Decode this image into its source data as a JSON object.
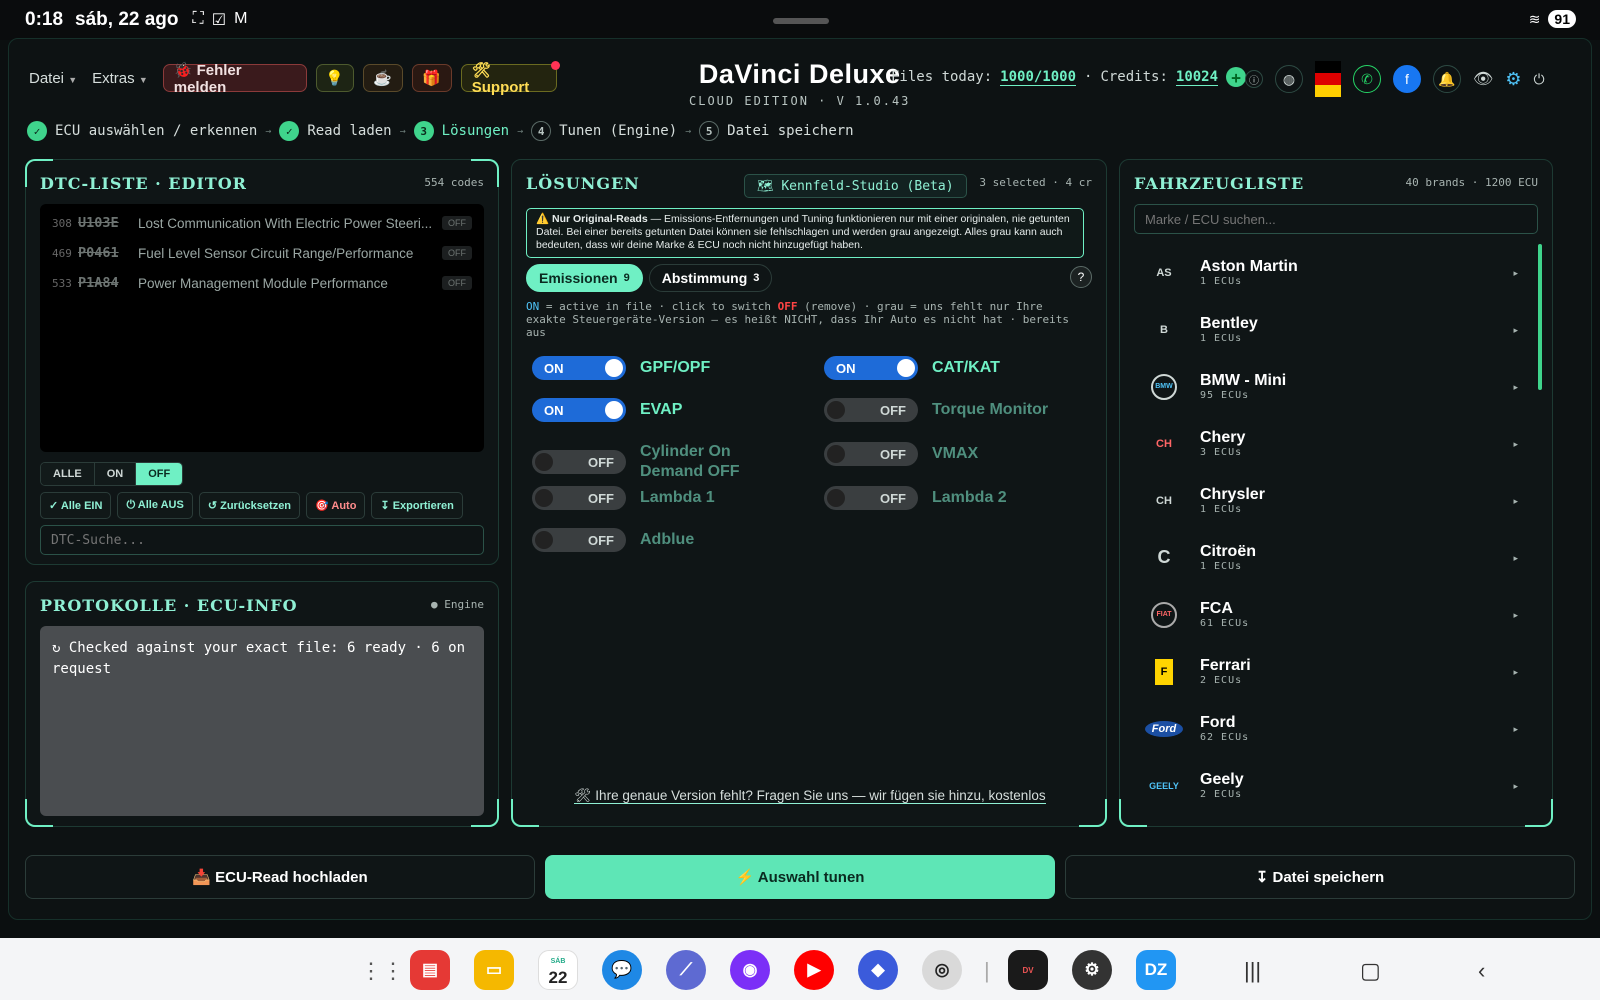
{
  "statusbar": {
    "time": "0:18",
    "date": "sáb, 22 ago",
    "battery": "91"
  },
  "menu": {
    "datei": "Datei",
    "extras": "Extras"
  },
  "toolbar": {
    "report": "🐞 Fehler melden",
    "idea": "💡",
    "coffee": "☕",
    "gift": "🎁",
    "support": "🛠Support"
  },
  "brand": {
    "title": "DaVinci Deluxe",
    "subtitle": "CLOUD EDITION · V 1.0.43"
  },
  "stats": {
    "files_label": "Files today:",
    "files_value": "1000/1000",
    "sep": "·",
    "credits_label": "Credits:",
    "credits_value": "10024",
    "plus": "+"
  },
  "steps": [
    {
      "num": "✓",
      "label": "ECU auswählen / erkennen"
    },
    {
      "num": "✓",
      "label": "Read laden"
    },
    {
      "num": "3",
      "label": "Lösungen"
    },
    {
      "num": "4",
      "label": "Tunen (Engine)"
    },
    {
      "num": "5",
      "label": "Datei speichern"
    }
  ],
  "dtc": {
    "title": "DTC-LISTE · EDITOR",
    "meta": "554 codes",
    "rows": [
      {
        "num": "308",
        "code": "U103E",
        "desc": "Lost Communication With Electric Power Steeri...",
        "state": "OFF"
      },
      {
        "num": "469",
        "code": "P0461",
        "desc": "Fuel Level Sensor Circuit Range/Performance",
        "state": "OFF"
      },
      {
        "num": "533",
        "code": "P1A84",
        "desc": "Power Management Module Performance",
        "state": "OFF"
      }
    ],
    "filters": [
      "ALLE",
      "ON",
      "OFF"
    ],
    "actions": [
      "✓ Alle EIN",
      "⏻ Alle AUS",
      "↺ Zurücksetzen",
      "🎯 Auto",
      "↧ Exportieren"
    ],
    "search_placeholder": "DTC-Suche..."
  },
  "proto": {
    "title": "PROTOKOLLE · ECU-INFO",
    "meta": "● Engine",
    "text": "↻ Checked against your exact file: 6 ready · 6 on request"
  },
  "loesungen": {
    "title": "LÖSUNGEN",
    "kennfeld": "🗺 Kennfeld-Studio (Beta)",
    "meta": "3 selected · 4 cr",
    "notice_bold": "⚠️ Nur Original-Reads",
    "notice_text": " — Emissions-Entfernungen und Tuning funktionieren nur mit einer originalen, nie getunten Datei. Bei einer bereits getunten Datei können sie fehlschlagen und werden grau angezeigt. Alles grau kann auch bedeuten, dass wir deine Marke & ECU noch nicht hinzugefügt haben.",
    "tabs": [
      {
        "label": "Emissionen",
        "count": "9"
      },
      {
        "label": "Abstimmung",
        "count": "3"
      }
    ],
    "help": "?",
    "legend_on": "ON",
    "legend_1": " = active in file · click to switch ",
    "legend_off": "OFF",
    "legend_2": " (remove)  ·  grau = uns fehlt nur Ihre exakte Steuergeräte-Version — es heißt NICHT, dass Ihr Auto es nicht hat · bereits aus",
    "toggles": [
      {
        "label": "GPF/OPF",
        "state": "ON"
      },
      {
        "label": "CAT/KAT",
        "state": "ON"
      },
      {
        "label": "EVAP",
        "state": "ON"
      },
      {
        "label": "Torque Monitor",
        "state": "OFF"
      },
      {
        "label": "Cylinder On Demand OFF",
        "state": "OFF"
      },
      {
        "label": "VMAX",
        "state": "OFF"
      },
      {
        "label": "Lambda 1",
        "state": "OFF"
      },
      {
        "label": "Lambda 2",
        "state": "OFF"
      },
      {
        "label": "Adblue",
        "state": "OFF"
      }
    ],
    "ask": "🛠 Ihre genaue Version fehlt? Fragen Sie uns — wir fügen sie hinzu, kostenlos"
  },
  "fahrzeug": {
    "title": "FAHRZEUGLISTE",
    "meta": "40 brands · 1200 ECU",
    "search_placeholder": "Marke / ECU suchen...",
    "brands": [
      {
        "name": "Aston Martin",
        "ecus": "1 ECUs",
        "logo": "AS"
      },
      {
        "name": "Bentley",
        "ecus": "1 ECUs",
        "logo": "B"
      },
      {
        "name": "BMW - Mini",
        "ecus": "95 ECUs",
        "logo": "BMW"
      },
      {
        "name": "Chery",
        "ecus": "3 ECUs",
        "logo": "CH"
      },
      {
        "name": "Chrysler",
        "ecus": "1 ECUs",
        "logo": "CH"
      },
      {
        "name": "Citroën",
        "ecus": "1 ECUs",
        "logo": "C"
      },
      {
        "name": "FCA",
        "ecus": "61 ECUs",
        "logo": "FIAT"
      },
      {
        "name": "Ferrari",
        "ecus": "2 ECUs",
        "logo": "F"
      },
      {
        "name": "Ford",
        "ecus": "62 ECUs",
        "logo": "Ford"
      },
      {
        "name": "Geely",
        "ecus": "2 ECUs",
        "logo": "GEELY"
      }
    ]
  },
  "bottom": {
    "upload": "📥 ECU-Read hochladen",
    "tune": "⚡ Auswahl tunen",
    "save": "↧ Datei speichern"
  },
  "nav": {
    "calendar_day": "22",
    "calendar_month": "SÁB",
    "dz": "DZ"
  }
}
